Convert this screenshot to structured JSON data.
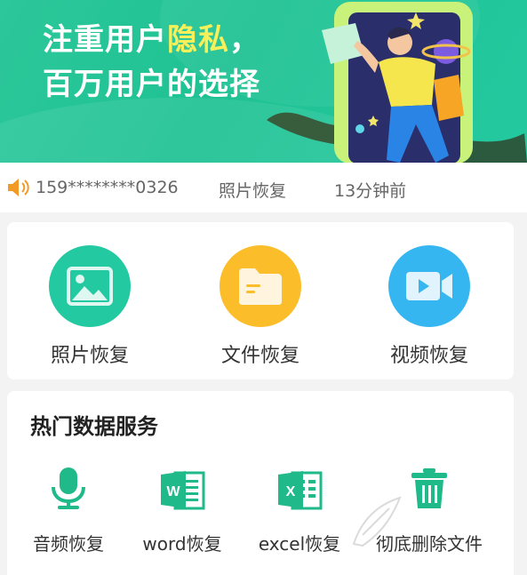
{
  "banner": {
    "line1_pre": "注重用户",
    "line1_highlight": "隐私",
    "line1_post": "，",
    "line2": "百万用户的选择"
  },
  "ticker": {
    "icon": "speaker-icon",
    "phone": "159********0326",
    "type": "照片恢复",
    "time": "13分钟前"
  },
  "tools": [
    {
      "label": "照片恢复",
      "icon": "image-icon",
      "color": "#23c9a0"
    },
    {
      "label": "文件恢复",
      "icon": "folder-icon",
      "color": "#fbbd29"
    },
    {
      "label": "视频恢复",
      "icon": "video-icon",
      "color": "#35b6f0"
    }
  ],
  "services": {
    "title": "热门数据服务",
    "items": [
      {
        "label": "音频恢复",
        "icon": "microphone-icon"
      },
      {
        "label": "word恢复",
        "icon": "word-icon"
      },
      {
        "label": "excel恢复",
        "icon": "excel-icon"
      },
      {
        "label": "彻底删除文件",
        "icon": "trash-icon"
      }
    ]
  },
  "colors": {
    "brand_green": "#1ec293",
    "highlight_yellow": "#f6f05a",
    "ticker_orange": "#f39a26"
  }
}
